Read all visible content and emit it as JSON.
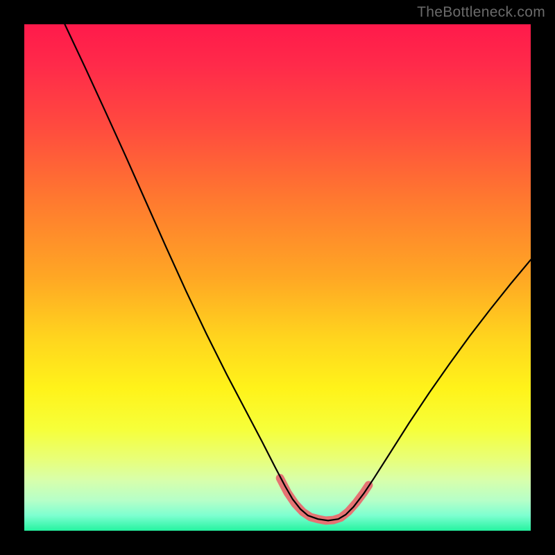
{
  "watermark": "TheBottleneck.com",
  "chart_data": {
    "type": "line",
    "title": "",
    "xlabel": "",
    "ylabel": "",
    "xlim": [
      0,
      100
    ],
    "ylim": [
      0,
      100
    ],
    "x_center_region": [
      52,
      66
    ],
    "gradient_stops": [
      {
        "offset": 0.0,
        "color": "#ff1a4b"
      },
      {
        "offset": 0.08,
        "color": "#ff2a4a"
      },
      {
        "offset": 0.2,
        "color": "#ff4a3f"
      },
      {
        "offset": 0.35,
        "color": "#ff7a2f"
      },
      {
        "offset": 0.5,
        "color": "#ffa724"
      },
      {
        "offset": 0.62,
        "color": "#ffd51e"
      },
      {
        "offset": 0.72,
        "color": "#fff31a"
      },
      {
        "offset": 0.8,
        "color": "#f6ff3a"
      },
      {
        "offset": 0.86,
        "color": "#e8ff7a"
      },
      {
        "offset": 0.9,
        "color": "#d8ffab"
      },
      {
        "offset": 0.94,
        "color": "#b6ffc8"
      },
      {
        "offset": 0.97,
        "color": "#7dffd0"
      },
      {
        "offset": 1.0,
        "color": "#25f3a0"
      }
    ],
    "series": [
      {
        "name": "bottleneck-curve",
        "color": "#000000",
        "points": [
          {
            "x": 8.0,
            "y": 100.0
          },
          {
            "x": 12.0,
            "y": 91.5
          },
          {
            "x": 16.0,
            "y": 82.8
          },
          {
            "x": 20.0,
            "y": 74.0
          },
          {
            "x": 24.0,
            "y": 65.0
          },
          {
            "x": 28.0,
            "y": 56.0
          },
          {
            "x": 32.0,
            "y": 47.2
          },
          {
            "x": 36.0,
            "y": 38.8
          },
          {
            "x": 40.0,
            "y": 30.8
          },
          {
            "x": 44.0,
            "y": 23.2
          },
          {
            "x": 47.0,
            "y": 17.5
          },
          {
            "x": 49.5,
            "y": 12.6
          },
          {
            "x": 51.5,
            "y": 8.8
          },
          {
            "x": 53.0,
            "y": 6.2
          },
          {
            "x": 54.5,
            "y": 4.3
          },
          {
            "x": 56.0,
            "y": 3.0
          },
          {
            "x": 58.0,
            "y": 2.3
          },
          {
            "x": 60.0,
            "y": 2.0
          },
          {
            "x": 62.0,
            "y": 2.3
          },
          {
            "x": 63.5,
            "y": 3.2
          },
          {
            "x": 65.0,
            "y": 4.7
          },
          {
            "x": 67.0,
            "y": 7.3
          },
          {
            "x": 69.0,
            "y": 10.3
          },
          {
            "x": 72.0,
            "y": 15.0
          },
          {
            "x": 76.0,
            "y": 21.3
          },
          {
            "x": 80.0,
            "y": 27.3
          },
          {
            "x": 84.0,
            "y": 33.0
          },
          {
            "x": 88.0,
            "y": 38.5
          },
          {
            "x": 92.0,
            "y": 43.7
          },
          {
            "x": 96.0,
            "y": 48.7
          },
          {
            "x": 100.0,
            "y": 53.5
          }
        ]
      },
      {
        "name": "bottom-highlight",
        "color": "#e57373",
        "stroke_width_px": 12,
        "points": [
          {
            "x": 50.5,
            "y": 10.4
          },
          {
            "x": 52.0,
            "y": 7.5
          },
          {
            "x": 53.5,
            "y": 5.3
          },
          {
            "x": 55.0,
            "y": 3.7
          },
          {
            "x": 56.5,
            "y": 2.7
          },
          {
            "x": 58.0,
            "y": 2.3
          },
          {
            "x": 59.5,
            "y": 2.0
          },
          {
            "x": 61.0,
            "y": 2.1
          },
          {
            "x": 62.5,
            "y": 2.6
          },
          {
            "x": 64.0,
            "y": 3.8
          },
          {
            "x": 65.5,
            "y": 5.5
          },
          {
            "x": 67.0,
            "y": 7.5
          },
          {
            "x": 68.0,
            "y": 9.0
          }
        ]
      }
    ]
  }
}
